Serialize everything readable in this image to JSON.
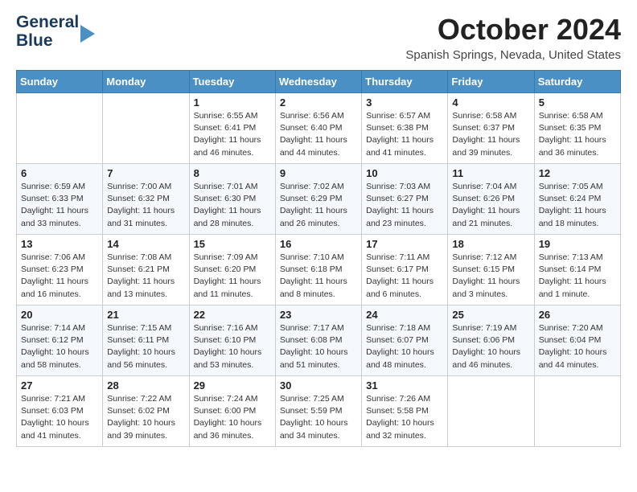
{
  "header": {
    "logo_line1": "General",
    "logo_line2": "Blue",
    "month": "October 2024",
    "location": "Spanish Springs, Nevada, United States"
  },
  "days_of_week": [
    "Sunday",
    "Monday",
    "Tuesday",
    "Wednesday",
    "Thursday",
    "Friday",
    "Saturday"
  ],
  "weeks": [
    [
      {
        "day": "",
        "text": ""
      },
      {
        "day": "",
        "text": ""
      },
      {
        "day": "1",
        "text": "Sunrise: 6:55 AM\nSunset: 6:41 PM\nDaylight: 11 hours and 46 minutes."
      },
      {
        "day": "2",
        "text": "Sunrise: 6:56 AM\nSunset: 6:40 PM\nDaylight: 11 hours and 44 minutes."
      },
      {
        "day": "3",
        "text": "Sunrise: 6:57 AM\nSunset: 6:38 PM\nDaylight: 11 hours and 41 minutes."
      },
      {
        "day": "4",
        "text": "Sunrise: 6:58 AM\nSunset: 6:37 PM\nDaylight: 11 hours and 39 minutes."
      },
      {
        "day": "5",
        "text": "Sunrise: 6:58 AM\nSunset: 6:35 PM\nDaylight: 11 hours and 36 minutes."
      }
    ],
    [
      {
        "day": "6",
        "text": "Sunrise: 6:59 AM\nSunset: 6:33 PM\nDaylight: 11 hours and 33 minutes."
      },
      {
        "day": "7",
        "text": "Sunrise: 7:00 AM\nSunset: 6:32 PM\nDaylight: 11 hours and 31 minutes."
      },
      {
        "day": "8",
        "text": "Sunrise: 7:01 AM\nSunset: 6:30 PM\nDaylight: 11 hours and 28 minutes."
      },
      {
        "day": "9",
        "text": "Sunrise: 7:02 AM\nSunset: 6:29 PM\nDaylight: 11 hours and 26 minutes."
      },
      {
        "day": "10",
        "text": "Sunrise: 7:03 AM\nSunset: 6:27 PM\nDaylight: 11 hours and 23 minutes."
      },
      {
        "day": "11",
        "text": "Sunrise: 7:04 AM\nSunset: 6:26 PM\nDaylight: 11 hours and 21 minutes."
      },
      {
        "day": "12",
        "text": "Sunrise: 7:05 AM\nSunset: 6:24 PM\nDaylight: 11 hours and 18 minutes."
      }
    ],
    [
      {
        "day": "13",
        "text": "Sunrise: 7:06 AM\nSunset: 6:23 PM\nDaylight: 11 hours and 16 minutes."
      },
      {
        "day": "14",
        "text": "Sunrise: 7:08 AM\nSunset: 6:21 PM\nDaylight: 11 hours and 13 minutes."
      },
      {
        "day": "15",
        "text": "Sunrise: 7:09 AM\nSunset: 6:20 PM\nDaylight: 11 hours and 11 minutes."
      },
      {
        "day": "16",
        "text": "Sunrise: 7:10 AM\nSunset: 6:18 PM\nDaylight: 11 hours and 8 minutes."
      },
      {
        "day": "17",
        "text": "Sunrise: 7:11 AM\nSunset: 6:17 PM\nDaylight: 11 hours and 6 minutes."
      },
      {
        "day": "18",
        "text": "Sunrise: 7:12 AM\nSunset: 6:15 PM\nDaylight: 11 hours and 3 minutes."
      },
      {
        "day": "19",
        "text": "Sunrise: 7:13 AM\nSunset: 6:14 PM\nDaylight: 11 hours and 1 minute."
      }
    ],
    [
      {
        "day": "20",
        "text": "Sunrise: 7:14 AM\nSunset: 6:12 PM\nDaylight: 10 hours and 58 minutes."
      },
      {
        "day": "21",
        "text": "Sunrise: 7:15 AM\nSunset: 6:11 PM\nDaylight: 10 hours and 56 minutes."
      },
      {
        "day": "22",
        "text": "Sunrise: 7:16 AM\nSunset: 6:10 PM\nDaylight: 10 hours and 53 minutes."
      },
      {
        "day": "23",
        "text": "Sunrise: 7:17 AM\nSunset: 6:08 PM\nDaylight: 10 hours and 51 minutes."
      },
      {
        "day": "24",
        "text": "Sunrise: 7:18 AM\nSunset: 6:07 PM\nDaylight: 10 hours and 48 minutes."
      },
      {
        "day": "25",
        "text": "Sunrise: 7:19 AM\nSunset: 6:06 PM\nDaylight: 10 hours and 46 minutes."
      },
      {
        "day": "26",
        "text": "Sunrise: 7:20 AM\nSunset: 6:04 PM\nDaylight: 10 hours and 44 minutes."
      }
    ],
    [
      {
        "day": "27",
        "text": "Sunrise: 7:21 AM\nSunset: 6:03 PM\nDaylight: 10 hours and 41 minutes."
      },
      {
        "day": "28",
        "text": "Sunrise: 7:22 AM\nSunset: 6:02 PM\nDaylight: 10 hours and 39 minutes."
      },
      {
        "day": "29",
        "text": "Sunrise: 7:24 AM\nSunset: 6:00 PM\nDaylight: 10 hours and 36 minutes."
      },
      {
        "day": "30",
        "text": "Sunrise: 7:25 AM\nSunset: 5:59 PM\nDaylight: 10 hours and 34 minutes."
      },
      {
        "day": "31",
        "text": "Sunrise: 7:26 AM\nSunset: 5:58 PM\nDaylight: 10 hours and 32 minutes."
      },
      {
        "day": "",
        "text": ""
      },
      {
        "day": "",
        "text": ""
      }
    ]
  ]
}
